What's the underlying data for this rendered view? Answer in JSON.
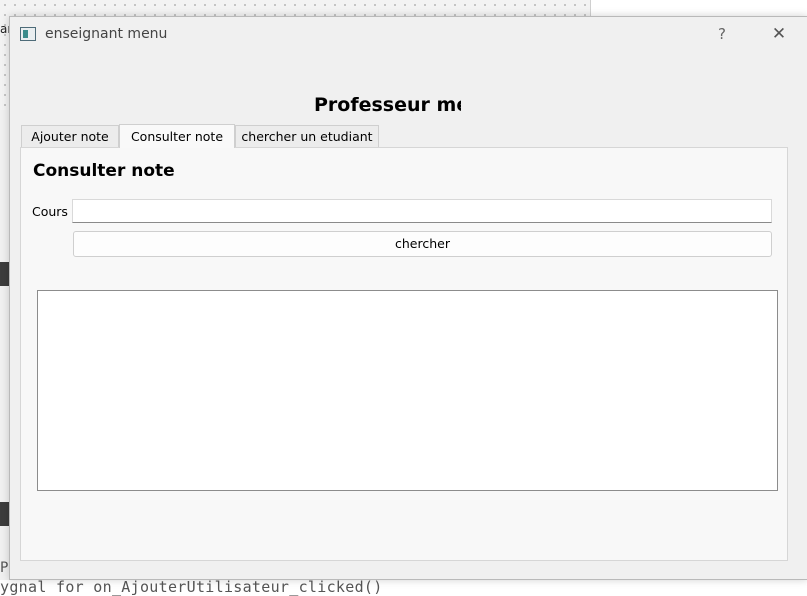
{
  "background": {
    "corner_text": "ar",
    "code_prefix": "P",
    "code_line": "ygnal for on_AjouterUtilisateur_clicked()"
  },
  "window": {
    "title": "enseignant menu",
    "help_label": "?",
    "close_label": "✕"
  },
  "main": {
    "heading": "Professeur menu",
    "tabs": [
      {
        "label": "Ajouter note",
        "active": false
      },
      {
        "label": "Consulter note",
        "active": true
      },
      {
        "label": "chercher un etudiant",
        "active": false
      }
    ],
    "panel": {
      "title": "Consulter  note",
      "cours_label": "Cours",
      "cours_value": "",
      "search_button": "chercher",
      "results": ""
    }
  },
  "colors": {
    "window_bg": "#f0f0f0",
    "panel_bg": "#f8f8f8",
    "input_bg": "#ffffff"
  }
}
